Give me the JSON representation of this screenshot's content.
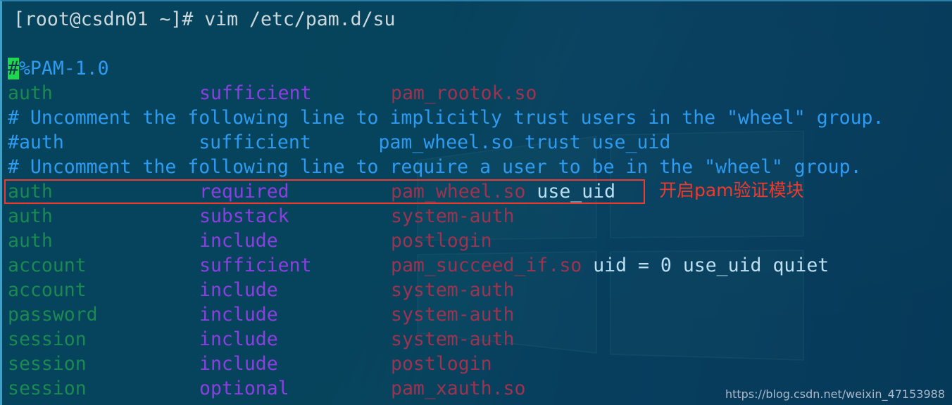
{
  "terminal": {
    "prompt": "[root@csdn01 ~]# vim /etc/pam.d/su",
    "blank": " ",
    "cursor_char": "#",
    "header_rest": "%PAM-1.0",
    "lines": [
      {
        "kind": "rule",
        "col1": "auth",
        "col2": "sufficient",
        "col3": "pam_rootok.so",
        "args": ""
      },
      {
        "kind": "comment",
        "text": "# Uncomment the following line to implicitly trust users in the \"wheel\" group."
      },
      {
        "kind": "comment",
        "text": "#auth            sufficient      pam_wheel.so trust use_uid"
      },
      {
        "kind": "comment",
        "text": "# Uncomment the following line to require a user to be in the \"wheel\" group."
      },
      {
        "kind": "rule",
        "col1": "auth",
        "col2": "required",
        "col3": "pam_wheel.so",
        "args": " use_uid",
        "highlighted": true
      },
      {
        "kind": "rule",
        "col1": "auth",
        "col2": "substack",
        "col3": "system-auth",
        "args": ""
      },
      {
        "kind": "rule",
        "col1": "auth",
        "col2": "include",
        "col3": "postlogin",
        "args": ""
      },
      {
        "kind": "rule",
        "col1": "account",
        "col2": "sufficient",
        "col3": "pam_succeed_if.so",
        "args": " uid = 0 use_uid quiet"
      },
      {
        "kind": "rule",
        "col1": "account",
        "col2": "include",
        "col3": "system-auth",
        "args": ""
      },
      {
        "kind": "rule",
        "col1": "password",
        "col2": "include",
        "col3": "system-auth",
        "args": ""
      },
      {
        "kind": "rule",
        "col1": "session",
        "col2": "include",
        "col3": "system-auth",
        "args": ""
      },
      {
        "kind": "rule",
        "col1": "session",
        "col2": "include",
        "col3": "postlogin",
        "args": ""
      },
      {
        "kind": "rule",
        "col1": "session",
        "col2": "optional",
        "col3": "pam_xauth.so",
        "args": ""
      }
    ]
  },
  "annotation": {
    "text": "开启pam验证模块",
    "color": "#f0392b"
  },
  "highlight_box": {
    "color": "#f0392b"
  },
  "watermark": {
    "text": "https://blog.csdn.net/weixin_47153988"
  },
  "colors": {
    "module_type": "#1a8a52",
    "control_flag": "#8b3fe0",
    "module_path": "#9e3350",
    "module_args": "#bcdff2",
    "comment": "#2d9bf0",
    "prompt": "#cdd8dd",
    "cursor_bg": "#1fd64f",
    "terminal_bg": "#04425a",
    "desktop_left": "#0a4a63",
    "desktop_right": "#0e2657"
  }
}
